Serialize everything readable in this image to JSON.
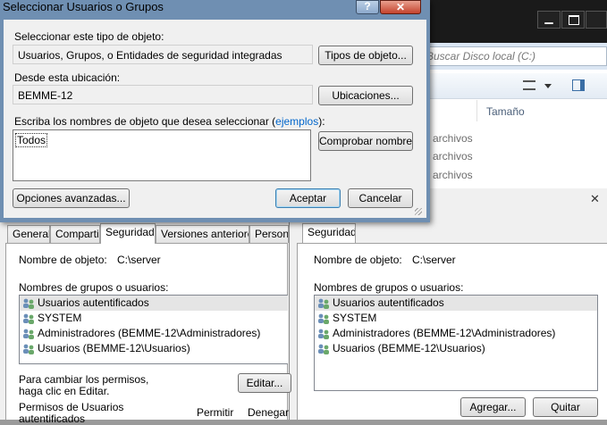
{
  "explorer": {
    "search_placeholder": "Buscar Disco local (C:)",
    "col_size": "Tamaño",
    "rows": [
      "archivos",
      "archivos",
      "archivos"
    ]
  },
  "props_left": {
    "tabs": [
      "General",
      "Compartir",
      "Seguridad",
      "Versiones anteriores",
      "Persona"
    ],
    "object_name_label": "Nombre de objeto:",
    "object_name_value": "C:\\server",
    "groups_label": "Nombres de grupos o usuarios:",
    "users": [
      "Usuarios autentificados",
      "SYSTEM",
      "Administradores (BEMME-12\\Administradores)",
      "Usuarios (BEMME-12\\Usuarios)"
    ],
    "change_hint_1": "Para cambiar los permisos,",
    "change_hint_2": "haga clic en Editar.",
    "edit_button": "Editar...",
    "perm_label_1": "Permisos de Usuarios",
    "perm_label_2": "autentificados",
    "col_allow": "Permitir",
    "col_deny": "Denegar"
  },
  "props_right": {
    "tab": "Seguridad",
    "object_name_label": "Nombre de objeto:",
    "object_name_value": "C:\\server",
    "groups_label": "Nombres de grupos o usuarios:",
    "users": [
      "Usuarios autentificados",
      "SYSTEM",
      "Administradores (BEMME-12\\Administradores)",
      "Usuarios (BEMME-12\\Usuarios)"
    ],
    "add_button": "Agregar...",
    "remove_button": "Quitar",
    "close_glyph": "✕"
  },
  "dialog": {
    "title": "Seleccionar Usuarios o Grupos",
    "help_glyph": "?",
    "close_glyph": "✕",
    "type_label": "Seleccionar este tipo de objeto:",
    "type_value": "Usuarios, Grupos, o Entidades de seguridad integradas",
    "types_button": "Tipos de objeto...",
    "location_label": "Desde esta ubicación:",
    "location_value": "BEMME-12",
    "locations_button": "Ubicaciones...",
    "names_label_prefix": "Escriba los nombres de objeto que desea seleccionar (",
    "names_label_link": "ejemplos",
    "names_label_suffix": "):",
    "names_value": "Todos",
    "check_button": "Comprobar nombres",
    "advanced_button": "Opciones avanzadas...",
    "ok_button": "Aceptar",
    "cancel_button": "Cancelar"
  },
  "colors": {
    "dialog_frame": "#6f8fb2",
    "link": "#0066cc",
    "default_button": "#3c7fb1"
  }
}
